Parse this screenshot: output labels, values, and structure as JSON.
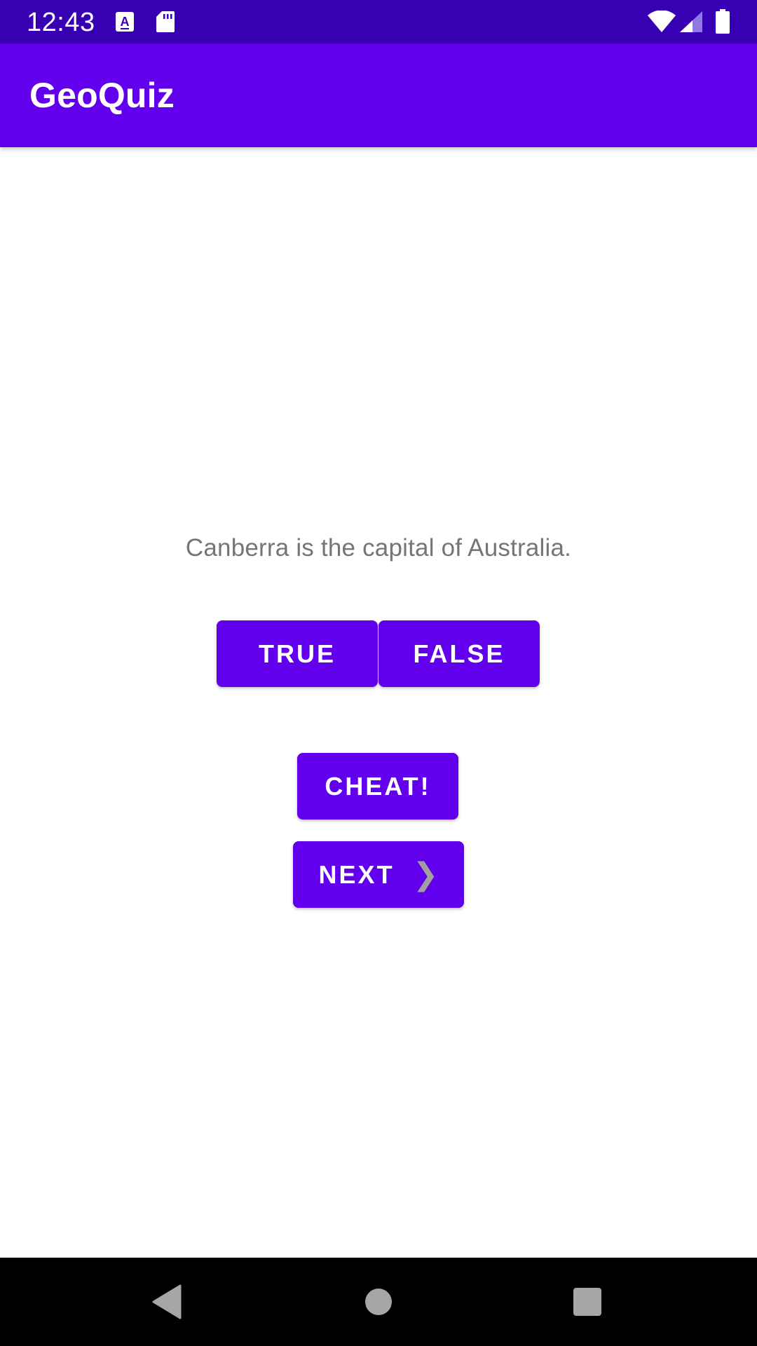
{
  "status_bar": {
    "time": "12:43",
    "icons": [
      "text-a-icon",
      "sd-card-icon",
      "wifi-icon",
      "cell-signal-icon",
      "battery-icon"
    ]
  },
  "app_bar": {
    "title": "GeoQuiz"
  },
  "quiz": {
    "question": "Canberra is the capital of Australia.",
    "true_label": "TRUE",
    "false_label": "FALSE",
    "cheat_label": "CHEAT!",
    "next_label": "NEXT",
    "next_arrow": "❯"
  },
  "nav_bar": {
    "icons": [
      "back-icon",
      "home-icon",
      "recents-icon"
    ]
  },
  "colors": {
    "status_bar": "#3700b3",
    "primary": "#6200ee",
    "question_text": "#757575",
    "nav_bar": "#000000"
  }
}
